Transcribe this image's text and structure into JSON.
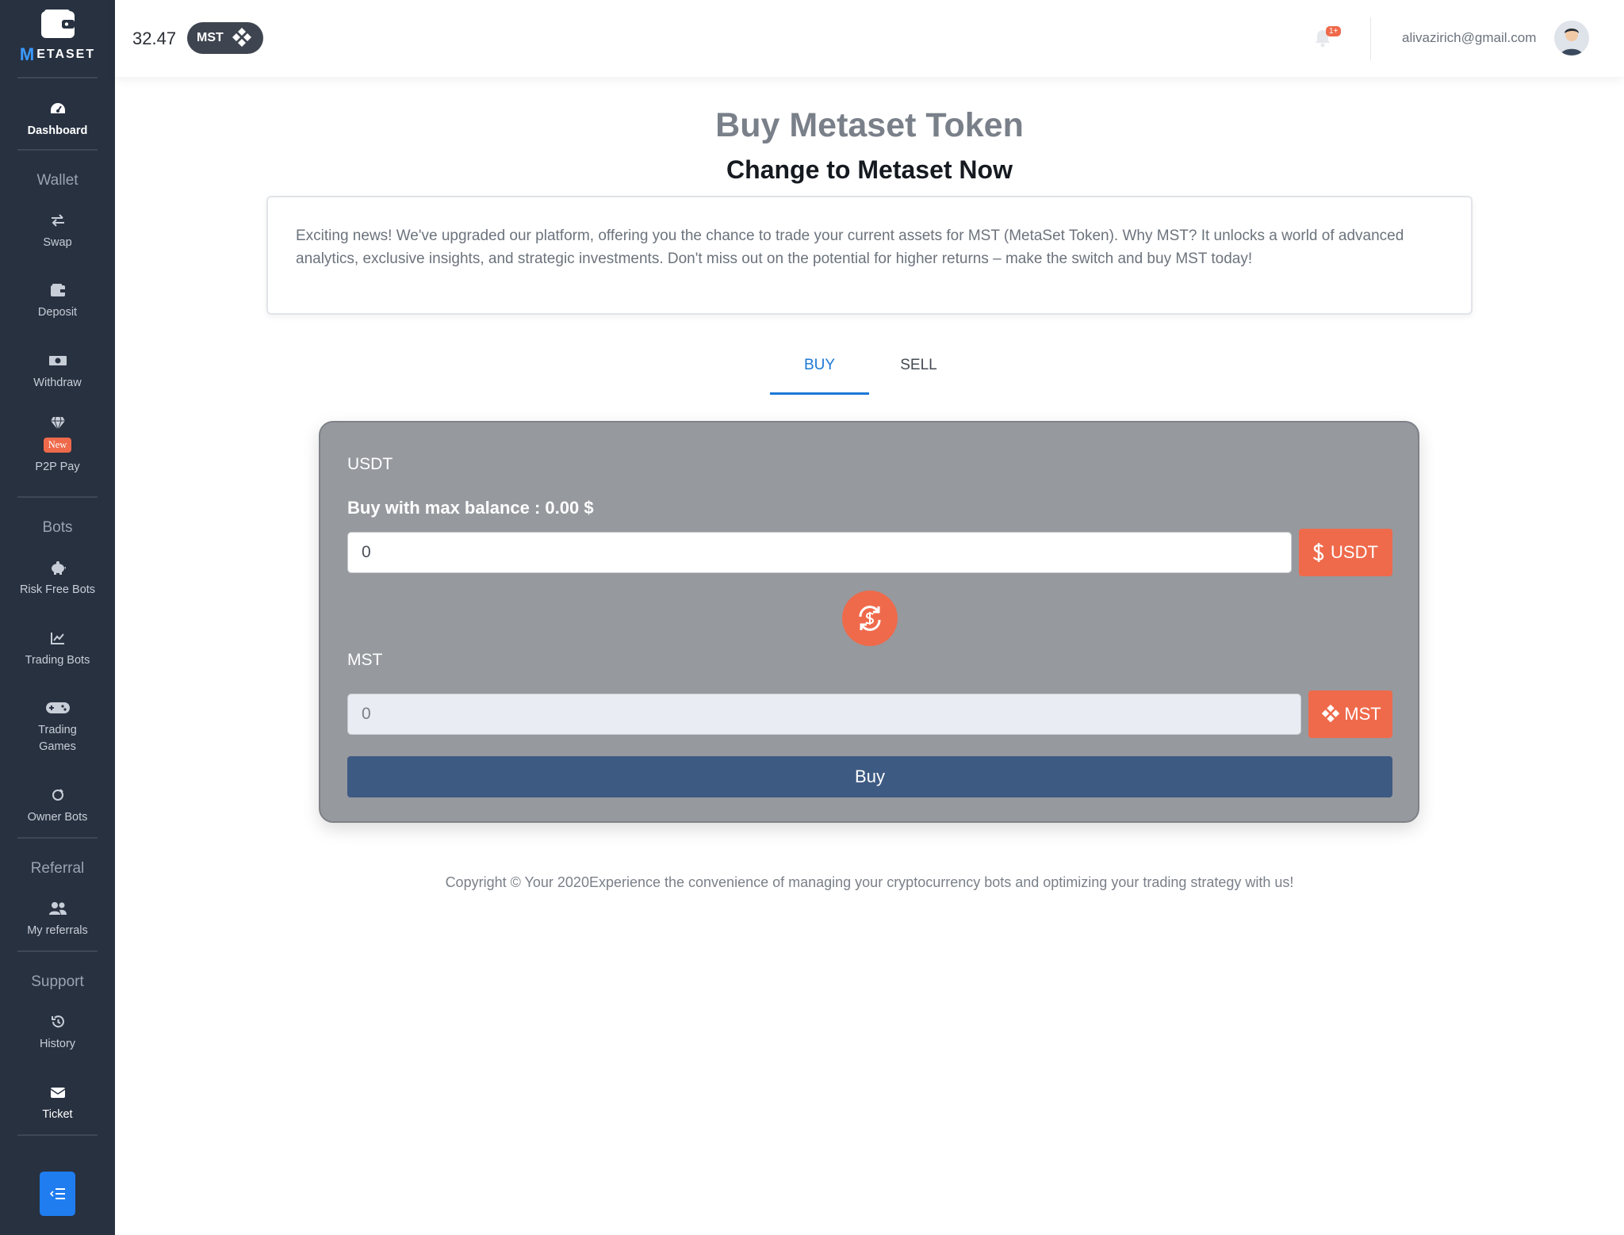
{
  "brand": {
    "name": "METASET",
    "first_letter": "M",
    "rest": "ETASET"
  },
  "sidebar": {
    "dashboard": "Dashboard",
    "sections": {
      "wallet": "Wallet",
      "bots": "Bots",
      "referral": "Referral",
      "support": "Support"
    },
    "items": {
      "swap": "Swap",
      "deposit": "Deposit",
      "withdraw": "Withdraw",
      "p2p_badge": "New",
      "p2p": "P2P Pay",
      "risk_free_bots": "Risk Free Bots",
      "trading_bots": "Trading Bots",
      "trading_games": "Trading Games",
      "owner_bots": "Owner Bots",
      "my_referrals": "My referrals",
      "history": "History",
      "ticket": "Ticket"
    }
  },
  "header": {
    "balance": "32.47",
    "token": "MST",
    "notification_badge": "1+",
    "email": "alivazirich@gmail.com"
  },
  "main": {
    "title": "Buy Metaset Token",
    "subtitle": "Change to Metaset Now",
    "info": "Exciting news! We've upgraded our platform, offering you the chance to trade your current assets for MST (MetaSet Token). Why MST? It unlocks a world of advanced analytics, exclusive insights, and strategic investments. Don't miss out on the potential for higher returns – make the switch and buy MST today!",
    "tabs": {
      "buy": "BUY",
      "sell": "SELL"
    },
    "form": {
      "from_label": "USDT",
      "max_balance": "Buy with max balance : 0.00 $",
      "from_value": "0",
      "from_currency": "USDT",
      "to_label": "MST",
      "to_value": "0",
      "to_currency": "MST",
      "buy_button": "Buy"
    }
  },
  "footer": {
    "text": "Copyright © Your 2020Experience the convenience of managing your cryptocurrency bots and optimizing your trading strategy with us!"
  },
  "colors": {
    "sidebar": "#283140",
    "accent": "#ef6a4b",
    "primary": "#3d5a82",
    "tab_active": "#1c78d6",
    "panel": "#96999e"
  }
}
